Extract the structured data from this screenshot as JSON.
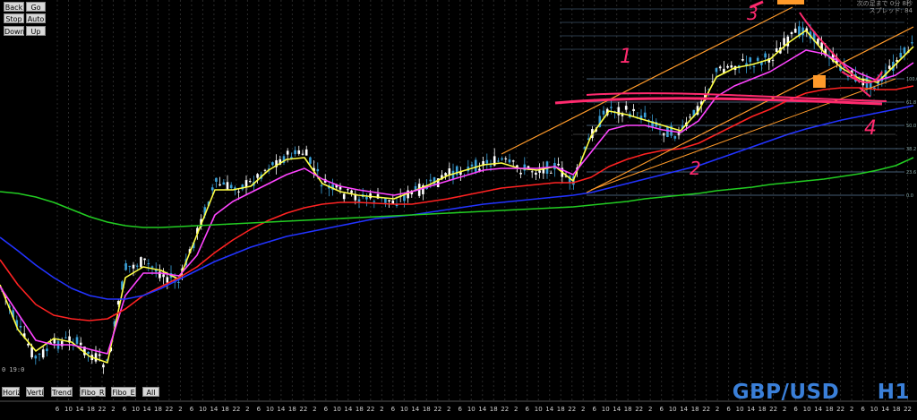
{
  "chart_data": {
    "type": "line",
    "symbol": "GBP/USD",
    "timeframe": "H1",
    "symbol_label": "GBP/USD     H1",
    "x_ticks": [
      "6",
      "10",
      "14",
      "18",
      "22",
      "2",
      "6",
      "10",
      "14",
      "18",
      "22",
      "2",
      "6",
      "10",
      "14",
      "18",
      "22",
      "2",
      "6",
      "10",
      "14",
      "18",
      "22",
      "2",
      "6",
      "10",
      "14",
      "18",
      "22",
      "2",
      "6",
      "10",
      "14",
      "18",
      "22",
      "2",
      "6",
      "10",
      "14",
      "18",
      "22",
      "2",
      "6",
      "10",
      "14",
      "18",
      "22",
      "2",
      "6",
      "10",
      "14",
      "18",
      "22",
      "2",
      "6",
      "10",
      "14",
      "18",
      "22",
      "2",
      "6",
      "10",
      "14",
      "18",
      "22",
      "2",
      "6",
      "10",
      "14",
      "18",
      "22",
      "2",
      "6",
      "10",
      "14",
      "18",
      "22"
    ],
    "price_series_x": [
      0,
      20,
      40,
      60,
      80,
      100,
      120,
      140,
      160,
      180,
      200,
      220,
      240,
      260,
      280,
      300,
      320,
      340,
      360,
      380,
      400,
      420,
      440,
      460,
      480,
      500,
      520,
      540,
      560,
      580,
      600,
      620,
      640,
      660,
      680,
      700,
      720,
      740,
      760,
      780,
      800,
      820,
      840,
      860,
      880,
      900,
      920,
      940,
      960,
      980,
      1000,
      1020
    ],
    "price_series_y": [
      318,
      365,
      400,
      385,
      378,
      395,
      408,
      300,
      292,
      305,
      316,
      260,
      205,
      210,
      205,
      185,
      175,
      170,
      205,
      215,
      220,
      222,
      225,
      215,
      208,
      195,
      190,
      182,
      180,
      188,
      190,
      185,
      205,
      150,
      120,
      125,
      130,
      145,
      150,
      120,
      80,
      72,
      70,
      65,
      45,
      30,
      55,
      75,
      90,
      95,
      70,
      50
    ],
    "series": [
      {
        "name": "",
        "color": "#ffff44",
        "values": [
          318,
          368,
          392,
          378,
          382,
          398,
          405,
          310,
          298,
          302,
          312,
          262,
          212,
          212,
          208,
          190,
          178,
          176,
          205,
          214,
          218,
          220,
          222,
          214,
          206,
          196,
          190,
          184,
          182,
          188,
          190,
          186,
          202,
          152,
          124,
          128,
          134,
          140,
          146,
          124,
          86,
          76,
          72,
          66,
          48,
          34,
          58,
          76,
          88,
          92,
          72,
          52
        ]
      },
      {
        "name": "",
        "color": "#ff44ff",
        "values": [
          320,
          350,
          380,
          385,
          385,
          390,
          395,
          330,
          305,
          305,
          308,
          285,
          240,
          225,
          215,
          205,
          195,
          188,
          200,
          208,
          212,
          215,
          218,
          214,
          208,
          202,
          196,
          190,
          188,
          188,
          188,
          186,
          195,
          170,
          145,
          140,
          140,
          145,
          148,
          135,
          108,
          96,
          88,
          80,
          68,
          56,
          60,
          70,
          82,
          90,
          84,
          70
        ]
      },
      {
        "name": "",
        "color": "#ff2222",
        "values": [
          290,
          318,
          340,
          352,
          356,
          358,
          356,
          345,
          330,
          320,
          310,
          298,
          282,
          268,
          256,
          246,
          238,
          232,
          228,
          226,
          226,
          227,
          228,
          228,
          225,
          222,
          218,
          214,
          210,
          208,
          206,
          204,
          204,
          198,
          186,
          178,
          172,
          168,
          166,
          160,
          150,
          140,
          130,
          122,
          112,
          104,
          100,
          98,
          98,
          100,
          100,
          96
        ]
      },
      {
        "name": "",
        "color": "#2233ff",
        "values": [
          265,
          280,
          296,
          310,
          322,
          330,
          334,
          334,
          330,
          322,
          312,
          302,
          292,
          284,
          276,
          270,
          264,
          260,
          256,
          252,
          248,
          244,
          242,
          240,
          237,
          234,
          231,
          228,
          226,
          224,
          222,
          220,
          218,
          215,
          210,
          205,
          200,
          195,
          190,
          185,
          178,
          171,
          164,
          157,
          150,
          144,
          139,
          134,
          130,
          126,
          122,
          118
        ]
      },
      {
        "name": "",
        "color": "#22cc22",
        "values": [
          214,
          216,
          220,
          226,
          234,
          242,
          248,
          252,
          254,
          254,
          253,
          252,
          251,
          250,
          249,
          248,
          247,
          246,
          245,
          244,
          243,
          242,
          241,
          240,
          239,
          238,
          237,
          236,
          235,
          234,
          233,
          232,
          231,
          229,
          227,
          225,
          222,
          220,
          218,
          216,
          213,
          211,
          209,
          206,
          204,
          202,
          200,
          197,
          194,
          190,
          185,
          176
        ]
      }
    ],
    "grid": true,
    "fibo_labels": [
      "100.0",
      "61.8",
      "50.0",
      "38.2",
      "23.6",
      "0.0"
    ],
    "annotations": [
      "1",
      "2",
      "3",
      "4"
    ]
  },
  "toolbar": {
    "back": "Back",
    "go": "Go",
    "stop": "Stop",
    "auto": "Auto",
    "down": "Down",
    "up": "Up"
  },
  "bottom_buttons": {
    "horiz": "Horiz",
    "verti": "Verti",
    "trend": "Trend",
    "fibo_r": "Fibo_R",
    "fibo_e": "Fibo_E",
    "all": "All"
  },
  "info": {
    "line1": "次の足まで 0分 8秒",
    "line2": "スプレッド: 84",
    "time": "0 19:0"
  },
  "colors": {
    "background": "#000000",
    "grid": "#2a2a2a",
    "candle_up": "#3aa0d8",
    "candle_down": "#ffffff",
    "symbol_text": "#3a7fd8",
    "trend_channel": "#ff9a2a",
    "pen_annotation": "#ff2a6e",
    "fibo": "#5a7a9a"
  }
}
